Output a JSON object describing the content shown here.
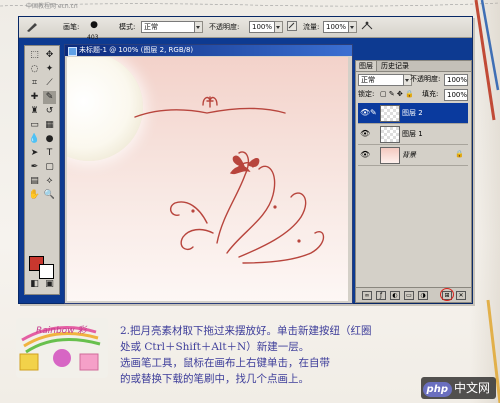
{
  "top_strip": "中国教程网 ecn.cn",
  "options_bar": {
    "brush_label": "画笔:",
    "brush_size": "403",
    "mode_label": "模式:",
    "mode_value": "正常",
    "opacity_label": "不透明度:",
    "opacity_value": "100%",
    "flow_label": "流量:",
    "flow_value": "100%"
  },
  "document": {
    "title": "未标题-1 @ 100% (图层 2, RGB/8)"
  },
  "layers_panel": {
    "tabs": [
      "图层",
      "历史记录"
    ],
    "blend_mode": "正常",
    "opacity_label": "不透明度:",
    "opacity_value": "100%",
    "lock_label": "锁定:",
    "fill_label": "填充:",
    "fill_value": "100%",
    "layers": [
      {
        "name": "图层 2",
        "selected": true
      },
      {
        "name": "图层 1",
        "selected": false
      },
      {
        "name": "背景",
        "selected": false
      }
    ]
  },
  "caption": {
    "line1": "2.把月亮素材取下拖过来摆放好。单击新建按纽（红圈",
    "line2": "处或 Ctrl＋Shift＋Alt＋N）新建一层。",
    "line3": "选画笔工具，鼠标在画布上右键单击，在自带",
    "line4": "的或替换下载的笔刷中，找几个点画上。"
  },
  "logo_text": "Rainbow 彩",
  "watermark": {
    "badge": "php",
    "text": "中文网"
  },
  "colors": {
    "foreground_swatch": "#c8372e",
    "selection": "#0a3a9e",
    "annotation_circle": "#d8211a"
  }
}
